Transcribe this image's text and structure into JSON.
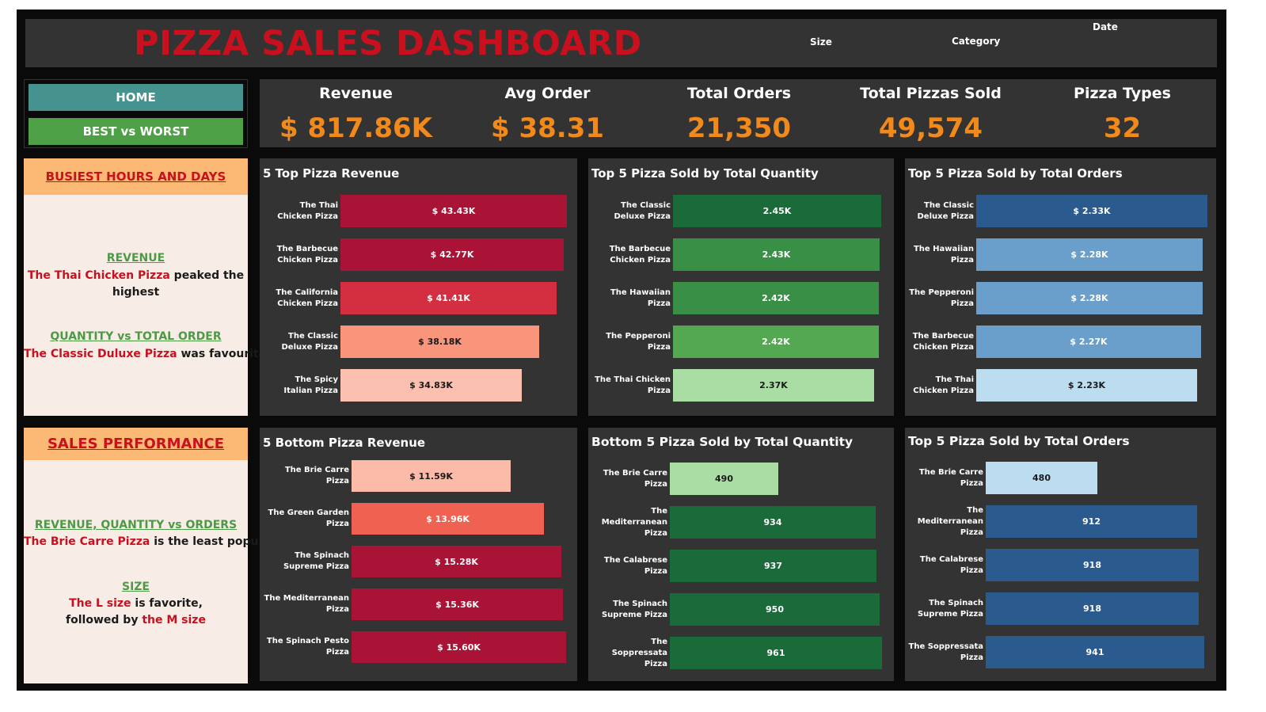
{
  "header": {
    "title": "PIZZA SALES DASHBOARD",
    "filters": {
      "size_label": "Size",
      "category_label": "Category",
      "date_label": "Date"
    }
  },
  "nav": {
    "home_label": "HOME",
    "best_worst_label": "BEST vs WORST"
  },
  "kpis": [
    {
      "label": "Revenue",
      "value": "$ 817.86K"
    },
    {
      "label": "Avg Order",
      "value": "$ 38.31"
    },
    {
      "label": "Total Orders",
      "value": "21,350"
    },
    {
      "label": "Total Pizzas Sold",
      "value": "49,574"
    },
    {
      "label": "Pizza Types",
      "value": "32"
    }
  ],
  "insights": {
    "busiest": {
      "heading": "BUSIEST HOURS AND DAYS",
      "revenue_title": "REVENUE",
      "revenue_red": "The Thai Chicken Pizza",
      "revenue_rest": " peaked the",
      "revenue_line2": "highest",
      "qty_title": "QUANTITY vs TOTAL ORDER",
      "qty_red": "The Classic Duluxe Pizza",
      "qty_rest": " was favourite"
    },
    "sales": {
      "heading": "SALES PERFORMANCE",
      "rqo_title": "REVENUE, QUANTITY vs ORDERS",
      "rqo_red": "The Brie Carre Pizza",
      "rqo_rest": "  is the least popular",
      "size_title": "SIZE",
      "size_red1": "The L size",
      "size_rest1": " is favorite,",
      "size_line2_black": "followed by ",
      "size_red2": "the M size"
    }
  },
  "chart_data": [
    {
      "type": "bar",
      "title": "5 Top Pizza Revenue",
      "categories": [
        "The Thai Chicken Pizza",
        "The Barbecue Chicken Pizza",
        "The California Chicken Pizza",
        "The Classic Deluxe Pizza",
        "The Spicy Italian Pizza"
      ],
      "values": [
        43.43,
        42.77,
        41.41,
        38.18,
        34.83
      ],
      "labels": [
        "$ 43.43K",
        "$ 42.77K",
        "$ 41.41K",
        "$ 38.18K",
        "$ 34.83K"
      ],
      "colors": [
        "#a91336",
        "#a91336",
        "#d42f40",
        "#f8957b",
        "#fcc0b0"
      ],
      "text_colors": [
        "#ffffff",
        "#ffffff",
        "#ffffff",
        "#1a1a1a",
        "#1a1a1a"
      ]
    },
    {
      "type": "bar",
      "title": "Top 5 Pizza Sold by Total Quantity",
      "categories": [
        "The Classic Deluxe Pizza",
        "The Barbecue Chicken Pizza",
        "The Hawaiian Pizza",
        "The Pepperoni Pizza",
        "The Thai Chicken Pizza"
      ],
      "values": [
        2.45,
        2.43,
        2.42,
        2.42,
        2.37
      ],
      "labels": [
        "2.45K",
        "2.43K",
        "2.42K",
        "2.42K",
        "2.37K"
      ],
      "colors": [
        "#1b6a3a",
        "#3a8f47",
        "#3a8f47",
        "#55a852",
        "#aadda3"
      ],
      "text_colors": [
        "#ffffff",
        "#ffffff",
        "#ffffff",
        "#ffffff",
        "#1a1a1a"
      ]
    },
    {
      "type": "bar",
      "title": "Top 5 Pizza Sold by Total Orders",
      "categories": [
        "The Classic Deluxe Pizza",
        "The Hawaiian Pizza",
        "The Pepperoni Pizza",
        "The Barbecue Chicken Pizza",
        "The Thai Chicken Pizza"
      ],
      "values": [
        2.33,
        2.28,
        2.28,
        2.27,
        2.23
      ],
      "labels": [
        "$ 2.33K",
        "$ 2.28K",
        "$ 2.28K",
        "$ 2.27K",
        "$ 2.23K"
      ],
      "colors": [
        "#2a5a8e",
        "#6b9fcb",
        "#6b9fcb",
        "#6b9fcb",
        "#bcdcf0"
      ],
      "text_colors": [
        "#ffffff",
        "#ffffff",
        "#ffffff",
        "#ffffff",
        "#1a1a1a"
      ]
    },
    {
      "type": "bar",
      "title": "5 Bottom Pizza Revenue",
      "categories": [
        "The Brie Carre Pizza",
        "The Green Garden Pizza",
        "The Spinach Supreme Pizza",
        "The Mediterranean Pizza",
        "The Spinach Pesto Pizza"
      ],
      "values": [
        11.59,
        13.96,
        15.28,
        15.36,
        15.6
      ],
      "labels": [
        "$ 11.59K",
        "$ 13.96K",
        "$ 15.28K",
        "$ 15.36K",
        "$ 15.60K"
      ],
      "colors": [
        "#fcbaa8",
        "#ef6150",
        "#a91336",
        "#a91336",
        "#a91336"
      ],
      "text_colors": [
        "#1a1a1a",
        "#ffffff",
        "#ffffff",
        "#ffffff",
        "#ffffff"
      ]
    },
    {
      "type": "bar",
      "title": "Bottom 5 Pizza Sold by Total Quantity",
      "categories": [
        "The Brie Carre Pizza",
        "The Mediterranean Pizza",
        "The Calabrese Pizza",
        "The Spinach Supreme Pizza",
        "The Soppressata Pizza"
      ],
      "values": [
        490,
        934,
        937,
        950,
        961
      ],
      "labels": [
        "490",
        "934",
        "937",
        "950",
        "961"
      ],
      "colors": [
        "#aadda3",
        "#1b6a3a",
        "#1b6a3a",
        "#1b6a3a",
        "#1b6a3a"
      ],
      "text_colors": [
        "#1a1a1a",
        "#ffffff",
        "#ffffff",
        "#ffffff",
        "#ffffff"
      ]
    },
    {
      "type": "bar",
      "title": "Top 5 Pizza Sold by Total Orders",
      "categories": [
        "The Brie Carre Pizza",
        "The Mediterranean Pizza",
        "The Calabrese Pizza",
        "The Spinach Supreme Pizza",
        "The Soppressata Pizza"
      ],
      "values": [
        480,
        912,
        918,
        918,
        941
      ],
      "labels": [
        "480",
        "912",
        "918",
        "918",
        "941"
      ],
      "colors": [
        "#bcdcf0",
        "#2a5a8e",
        "#2a5a8e",
        "#2a5a8e",
        "#2a5a8e"
      ],
      "text_colors": [
        "#1a1a1a",
        "#ffffff",
        "#ffffff",
        "#ffffff",
        "#ffffff"
      ]
    }
  ]
}
